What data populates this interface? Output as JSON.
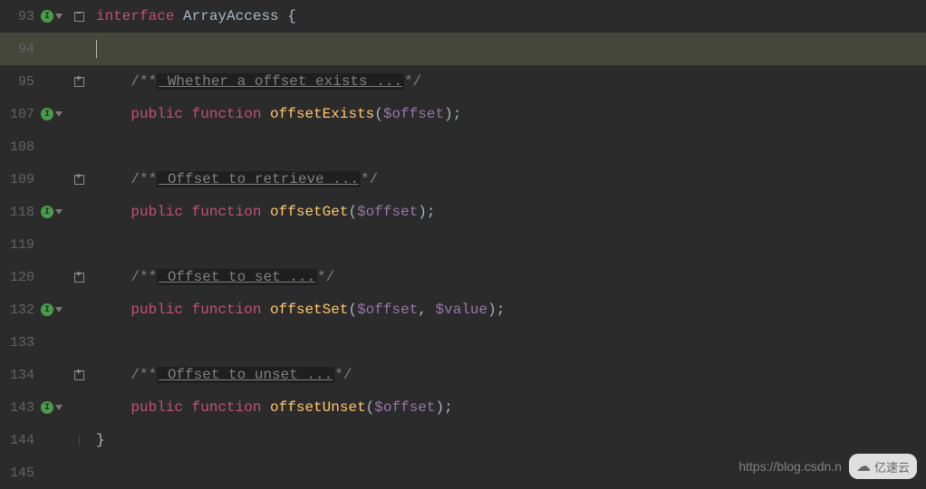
{
  "lines": [
    {
      "num": "93",
      "marker": "impl_arrow",
      "fold": "minus",
      "prefix": "",
      "tokens": [
        [
          "kw2",
          "interface"
        ],
        [
          "punct",
          " ArrayAccess {"
        ]
      ]
    },
    {
      "num": "94",
      "marker": "",
      "fold": "",
      "highlighted": true,
      "cursor": true,
      "prefix": "",
      "tokens": []
    },
    {
      "num": "95",
      "marker": "",
      "fold": "expand",
      "prefix": "    ",
      "tokens": [
        [
          "comment",
          "/**"
        ],
        [
          "folded",
          " Whether a offset exists ..."
        ],
        [
          "comment",
          "*/"
        ]
      ]
    },
    {
      "num": "107",
      "marker": "impl_arrow",
      "fold": "",
      "prefix": "    ",
      "tokens": [
        [
          "kw2",
          "public"
        ],
        [
          "punct",
          " "
        ],
        [
          "kw2",
          "function"
        ],
        [
          "punct",
          " "
        ],
        [
          "fn",
          "offsetExists"
        ],
        [
          "punct",
          "("
        ],
        [
          "var",
          "$offset"
        ],
        [
          "punct",
          ");"
        ]
      ]
    },
    {
      "num": "108",
      "marker": "",
      "fold": "",
      "prefix": "",
      "tokens": []
    },
    {
      "num": "109",
      "marker": "",
      "fold": "expand",
      "prefix": "    ",
      "tokens": [
        [
          "comment",
          "/**"
        ],
        [
          "folded",
          " Offset to retrieve ..."
        ],
        [
          "comment",
          "*/"
        ]
      ]
    },
    {
      "num": "118",
      "marker": "impl_arrow",
      "fold": "",
      "prefix": "    ",
      "tokens": [
        [
          "kw2",
          "public"
        ],
        [
          "punct",
          " "
        ],
        [
          "kw2",
          "function"
        ],
        [
          "punct",
          " "
        ],
        [
          "fn",
          "offsetGet"
        ],
        [
          "punct",
          "("
        ],
        [
          "var",
          "$offset"
        ],
        [
          "punct",
          ");"
        ]
      ]
    },
    {
      "num": "119",
      "marker": "",
      "fold": "",
      "prefix": "",
      "tokens": []
    },
    {
      "num": "120",
      "marker": "",
      "fold": "expand",
      "prefix": "    ",
      "tokens": [
        [
          "comment",
          "/**"
        ],
        [
          "folded",
          " Offset to set ..."
        ],
        [
          "comment",
          "*/"
        ]
      ]
    },
    {
      "num": "132",
      "marker": "impl_arrow",
      "fold": "",
      "prefix": "    ",
      "tokens": [
        [
          "kw2",
          "public"
        ],
        [
          "punct",
          " "
        ],
        [
          "kw2",
          "function"
        ],
        [
          "punct",
          " "
        ],
        [
          "fn",
          "offsetSet"
        ],
        [
          "punct",
          "("
        ],
        [
          "var",
          "$offset"
        ],
        [
          "punct",
          ", "
        ],
        [
          "var",
          "$value"
        ],
        [
          "punct",
          ");"
        ]
      ]
    },
    {
      "num": "133",
      "marker": "",
      "fold": "",
      "prefix": "",
      "tokens": []
    },
    {
      "num": "134",
      "marker": "",
      "fold": "expand",
      "prefix": "    ",
      "tokens": [
        [
          "comment",
          "/**"
        ],
        [
          "folded",
          " Offset to unset ..."
        ],
        [
          "comment",
          "*/"
        ]
      ]
    },
    {
      "num": "143",
      "marker": "impl_arrow",
      "fold": "",
      "prefix": "    ",
      "tokens": [
        [
          "kw2",
          "public"
        ],
        [
          "punct",
          " "
        ],
        [
          "kw2",
          "function"
        ],
        [
          "punct",
          " "
        ],
        [
          "fn",
          "offsetUnset"
        ],
        [
          "punct",
          "("
        ],
        [
          "var",
          "$offset"
        ],
        [
          "punct",
          ");"
        ]
      ]
    },
    {
      "num": "144",
      "marker": "",
      "fold": "end",
      "prefix": "",
      "tokens": [
        [
          "punct",
          "}"
        ]
      ]
    },
    {
      "num": "145",
      "marker": "",
      "fold": "none",
      "prefix": "",
      "tokens": []
    }
  ],
  "watermark": {
    "url": "https://blog.csdn.n",
    "brand": "亿速云"
  },
  "impl_letter": "I"
}
